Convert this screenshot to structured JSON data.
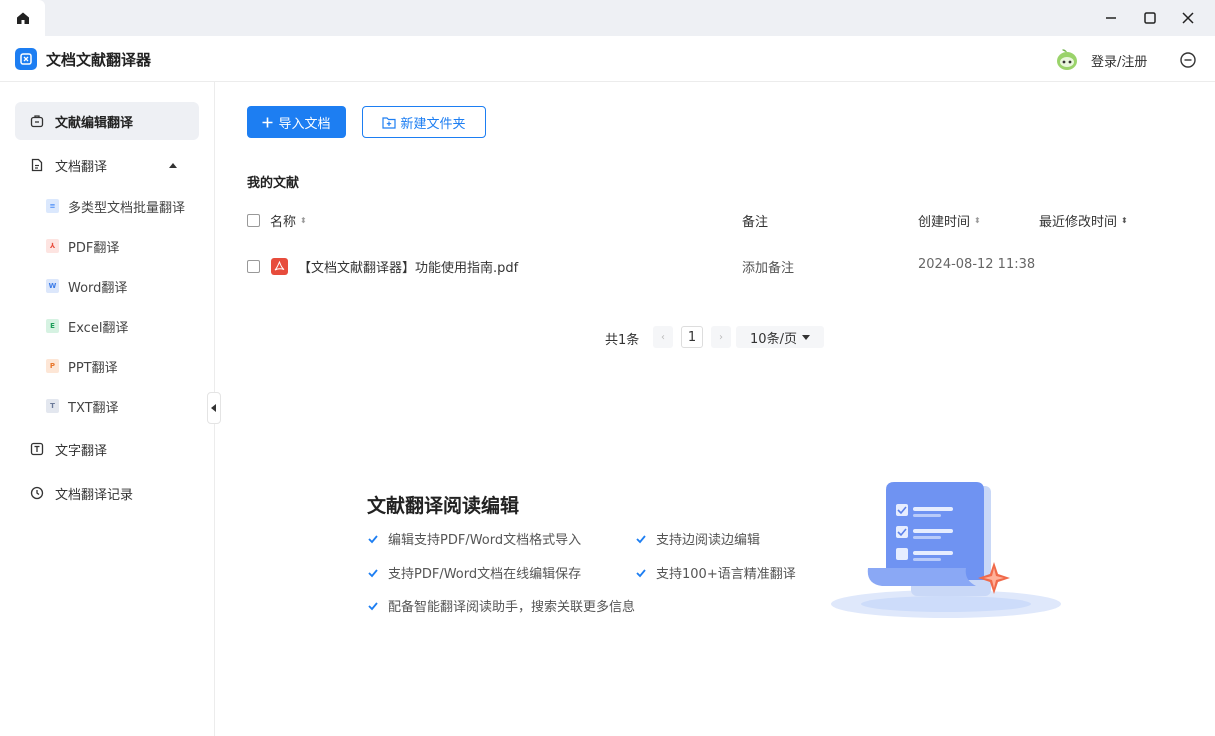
{
  "window": {
    "home_icon": "home-icon",
    "min_icon": "minimize-icon",
    "max_icon": "maximize-icon",
    "close_icon": "close-icon"
  },
  "app": {
    "title": "文档文献翻译器",
    "login_label": "登录/注册"
  },
  "sidebar": {
    "items": [
      {
        "label": "文献编辑翻译",
        "icon": "briefcase-icon",
        "active": true
      },
      {
        "label": "文档翻译",
        "icon": "document-icon"
      },
      {
        "label": "文字翻译",
        "icon": "text-icon"
      },
      {
        "label": "文档翻译记录",
        "icon": "clock-icon"
      }
    ],
    "sub_items": [
      {
        "label": "多类型文档批量翻译",
        "glyph": "≡",
        "color": "#4a8cf7",
        "bg": "#dbe8fd"
      },
      {
        "label": "PDF翻译",
        "glyph": "⅄",
        "color": "#e74c3c",
        "bg": "#fde4e1"
      },
      {
        "label": "Word翻译",
        "glyph": "W",
        "color": "#3b7be8",
        "bg": "#dce7fb"
      },
      {
        "label": "Excel翻译",
        "glyph": "E",
        "color": "#1e9e5a",
        "bg": "#d6f2e2"
      },
      {
        "label": "PPT翻译",
        "glyph": "P",
        "color": "#e8762c",
        "bg": "#fde6d6"
      },
      {
        "label": "TXT翻译",
        "glyph": "T",
        "color": "#6b7a99",
        "bg": "#e3e7ef"
      }
    ]
  },
  "toolbar": {
    "import_label": "导入文档",
    "new_folder_label": "新建文件夹"
  },
  "files": {
    "section_title": "我的文献",
    "columns": {
      "name": "名称",
      "note": "备注",
      "created": "创建时间",
      "modified": "最近修改时间"
    },
    "rows": [
      {
        "name": "【文档文献翻译器】功能使用指南.pdf",
        "note": "添加备注",
        "created": "2024-08-12 11:38",
        "modified": ""
      }
    ]
  },
  "pagination": {
    "total": "共1条",
    "prev": "‹",
    "page": "1",
    "next": "›",
    "page_size": "10条/页"
  },
  "promo": {
    "title": "文献翻译阅读编辑",
    "features": [
      "编辑支持PDF/Word文档格式导入",
      "支持边阅读边编辑",
      "支持PDF/Word文档在线编辑保存",
      "支持100+语言精准翻译",
      "配备智能翻译阅读助手，搜索关联更多信息"
    ]
  },
  "colors": {
    "accent": "#1d7ef2",
    "sidebar_active": "#eef0f4"
  }
}
